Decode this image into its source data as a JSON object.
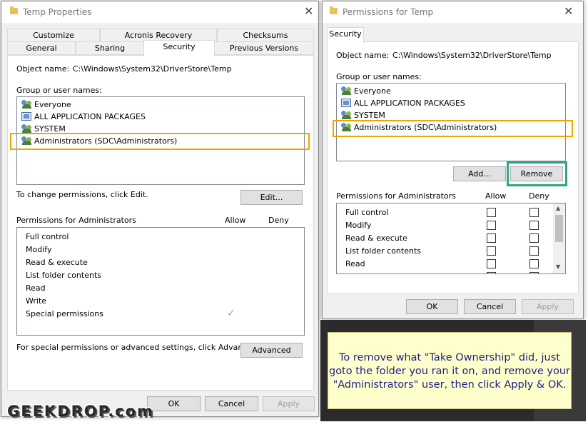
{
  "left_window": {
    "title": "Temp Properties",
    "tabs_row1": [
      "Customize",
      "Acronis Recovery",
      "Checksums"
    ],
    "tabs_row2": [
      "General",
      "Sharing",
      "Security",
      "Previous Versions"
    ],
    "object_name_label": "Object name:",
    "object_name_value": "C:\\Windows\\System32\\DriverStore\\Temp",
    "group_label": "Group or user names:",
    "users": [
      "Everyone",
      "ALL APPLICATION PACKAGES",
      "SYSTEM",
      "Administrators (SDC\\Administrators)"
    ],
    "change_text": "To change permissions, click Edit.",
    "edit_label": "Edit...",
    "perm_label": "Permissions for Administrators",
    "allow_label": "Allow",
    "deny_label": "Deny",
    "permissions": [
      "Full control",
      "Modify",
      "Read & execute",
      "List folder contents",
      "Read",
      "Write",
      "Special permissions"
    ],
    "special_text": "For special permissions or advanced settings, click Advanced.",
    "advanced_label": "Advanced",
    "ok_label": "OK",
    "cancel_label": "Cancel",
    "apply_label": "Apply"
  },
  "right_window": {
    "title": "Permissions for Temp",
    "tab": "Security",
    "object_name_label": "Object name:",
    "object_name_value": "C:\\Windows\\System32\\DriverStore\\Temp",
    "group_label": "Group or user names:",
    "users": [
      "Everyone",
      "ALL APPLICATION PACKAGES",
      "SYSTEM",
      "Administrators (SDC\\Administrators)"
    ],
    "add_label": "Add...",
    "remove_label": "Remove",
    "perm_label": "Permissions for Administrators",
    "allow_label": "Allow",
    "deny_label": "Deny",
    "permissions": [
      "Full control",
      "Modify",
      "Read & execute",
      "List folder contents",
      "Read"
    ],
    "ok_label": "OK",
    "cancel_label": "Cancel",
    "apply_label": "Apply"
  },
  "note": {
    "line1": "To remove what \"Take Ownership\" did, just",
    "line2": "goto the folder you ran it on, and remove your",
    "line3": "\"Administrators\" user, then click Apply & OK."
  },
  "watermark": "GEEKDROP.com",
  "colors": {
    "highlight_orange": "#f0a500",
    "highlight_green": "#2aa687",
    "note_bg": "#ffffcc",
    "note_text": "#1f1f8a"
  }
}
